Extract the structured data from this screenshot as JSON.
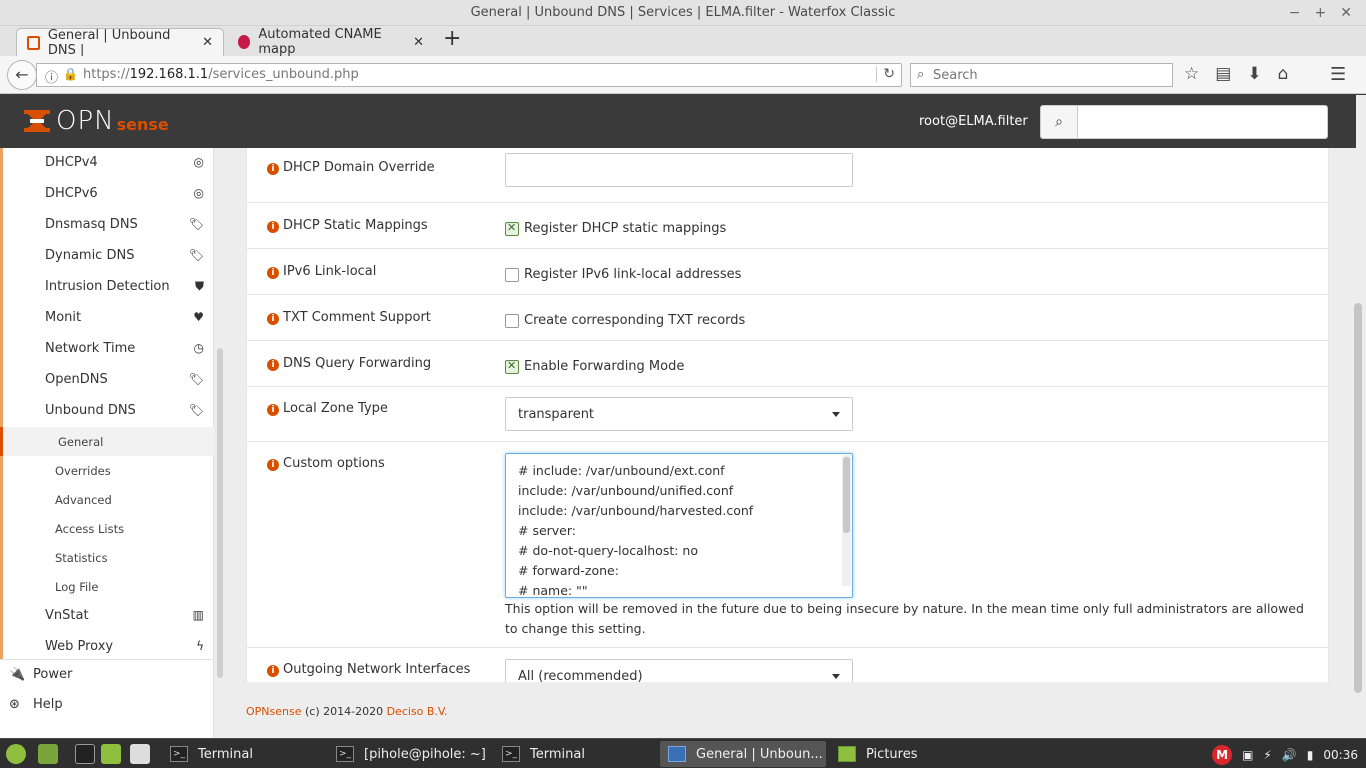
{
  "window": {
    "title": "General | Unbound DNS | Services | ELMA.filter - Waterfox Classic"
  },
  "tabs": [
    {
      "label": "General | Unbound DNS |",
      "active": true
    },
    {
      "label": "Automated CNAME mapp",
      "active": false
    }
  ],
  "nav": {
    "url_prefix": "https://",
    "url_host": "192.168.1.1",
    "url_path": "/services_unbound.php",
    "search_placeholder": "Search"
  },
  "header": {
    "logo_opn": "OPN",
    "logo_sense": "sense",
    "user": "root@ELMA.filter"
  },
  "sidebar": {
    "items": [
      {
        "label": "DHCPv4",
        "icon": "◎"
      },
      {
        "label": "DHCPv6",
        "icon": "◎"
      },
      {
        "label": "Dnsmasq DNS",
        "icon": "🏷"
      },
      {
        "label": "Dynamic DNS",
        "icon": "🏷"
      },
      {
        "label": "Intrusion Detection",
        "icon": "⛊"
      },
      {
        "label": "Monit",
        "icon": "♥"
      },
      {
        "label": "Network Time",
        "icon": "◷"
      },
      {
        "label": "OpenDNS",
        "icon": "🏷"
      },
      {
        "label": "Unbound DNS",
        "icon": "🏷"
      }
    ],
    "subitems": [
      "General",
      "Overrides",
      "Advanced",
      "Access Lists",
      "Statistics",
      "Log File"
    ],
    "items2": [
      {
        "label": "VnStat",
        "icon": "▥"
      },
      {
        "label": "Web Proxy",
        "icon": "ϟ"
      }
    ],
    "bottom": [
      {
        "label": "Power",
        "icon": "🔌"
      },
      {
        "label": "Help",
        "icon": "⊛"
      }
    ]
  },
  "form": {
    "dhcp_domain_override": {
      "label": "DHCP Domain Override",
      "value": ""
    },
    "dhcp_static": {
      "label": "DHCP Static Mappings",
      "text": "Register DHCP static mappings",
      "checked": true
    },
    "ipv6_ll": {
      "label": "IPv6 Link-local",
      "text": "Register IPv6 link-local addresses",
      "checked": false
    },
    "txt_comment": {
      "label": "TXT Comment Support",
      "text": "Create corresponding TXT records",
      "checked": false
    },
    "dns_forward": {
      "label": "DNS Query Forwarding",
      "text": "Enable Forwarding Mode",
      "checked": true
    },
    "local_zone": {
      "label": "Local Zone Type",
      "value": "transparent"
    },
    "custom": {
      "label": "Custom options",
      "lines": [
        "# include: /var/unbound/ext.conf",
        "include: /var/unbound/unified.conf",
        "include: /var/unbound/harvested.conf",
        "# server:",
        "# do-not-query-localhost: no",
        "# forward-zone:",
        "# name: \"\""
      ],
      "hint": "This option will be removed in the future due to being insecure by nature. In the mean time only full administrators are allowed to change this setting."
    },
    "outgoing": {
      "label": "Outgoing Network Interfaces",
      "value": "All (recommended)"
    }
  },
  "footer": {
    "brand": "OPNsense",
    "copy": " (c) 2014-2020 ",
    "company": "Deciso B.V."
  },
  "taskbar": {
    "items": [
      {
        "label": "Terminal",
        "active": false
      },
      {
        "label": "[pihole@pihole: ~]",
        "active": false
      },
      {
        "label": "Terminal",
        "active": false
      },
      {
        "label": "General | Unboun...",
        "active": true
      },
      {
        "label": "Pictures",
        "active": false
      }
    ],
    "clock": "00:36",
    "mega": "M"
  },
  "colors": {
    "accent": "#d94f00",
    "header_bg": "#3a3a3a",
    "sidebar_accent": "#e7a360"
  }
}
